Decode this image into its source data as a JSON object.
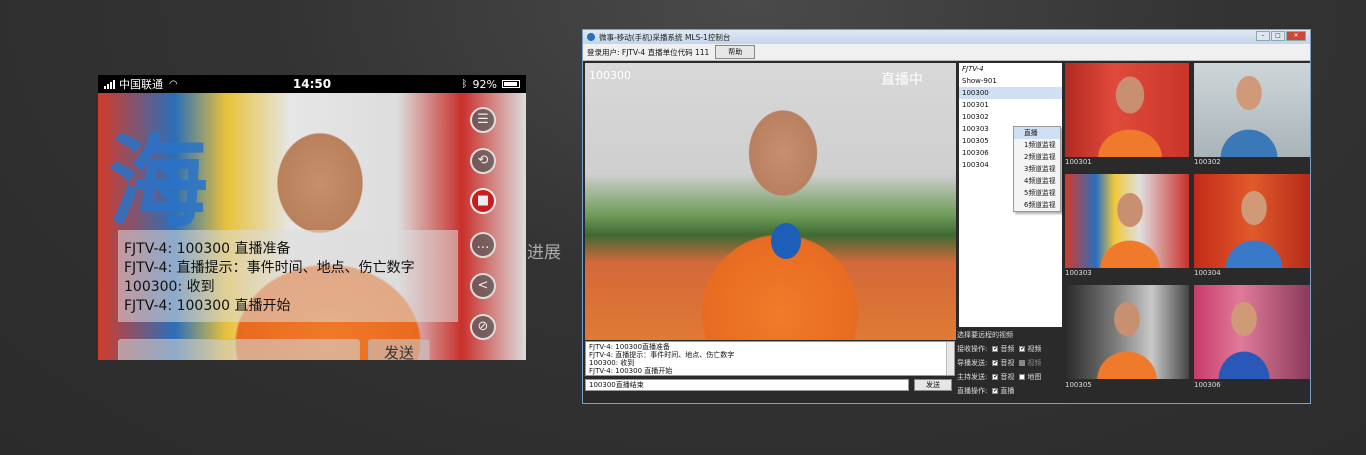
{
  "phone": {
    "carrier": "中国联通",
    "time": "14:50",
    "battery": "92%",
    "chat_lines": [
      "FJTV-4: 100300 直播准备",
      "FJTV-4: 直播提示：事件时间、地点、伤亡数字",
      "100300: 收到",
      "FJTV-4: 100300 直播开始"
    ],
    "send_label": "发送",
    "side_icons": [
      "list-icon",
      "camera-switch-icon",
      "record-icon",
      "chat-icon",
      "share-icon",
      "map-pin-icon"
    ]
  },
  "middle_label": "进展",
  "window": {
    "title": "微事-移动(手机)采播系统 MLS-1控制台",
    "login_info": "登录用户: FJTV-4 直播单位代码 111",
    "help_label": "帮助",
    "main_overlay_left": "100300",
    "main_overlay_right": "直播中",
    "list": {
      "header": "FJTV-4",
      "items": [
        "Show-901",
        "100300",
        "100301",
        "100302",
        "100303",
        "100305",
        "100306",
        "100304"
      ],
      "selected": "100300"
    },
    "context_menu": [
      "直播",
      "1频道监视",
      "2频道监视",
      "3频道监视",
      "4频道监视",
      "5频道监视",
      "6频道监视"
    ],
    "controls": {
      "title": "选择要远程的视频",
      "rows": [
        {
          "label": "接收操作:",
          "opts": [
            {
              "text": "音频",
              "on": true
            },
            {
              "text": "视频",
              "on": true
            }
          ]
        },
        {
          "label": "导播发送:",
          "opts": [
            {
              "text": "音视",
              "on": true
            },
            {
              "text": "视频",
              "on": false
            }
          ]
        },
        {
          "label": "主持发送:",
          "opts": [
            {
              "text": "音视",
              "on": true
            },
            {
              "text": "地图",
              "on": false
            }
          ]
        },
        {
          "label": "直播操作:",
          "opts": [
            {
              "text": "直播",
              "on": true
            }
          ]
        }
      ]
    },
    "chat_log": [
      "FJTV-4: 100300直播准备",
      "FJTV-4: 直播提示：事件时间、地点、伤亡数字",
      "100300: 收到",
      "FJTV-4: 100300 直播开始"
    ],
    "chat_input": "100300直播结束",
    "send_label": "发送",
    "thumbnails": [
      "100301",
      "100302",
      "100303",
      "100304",
      "100305",
      "100306"
    ]
  }
}
